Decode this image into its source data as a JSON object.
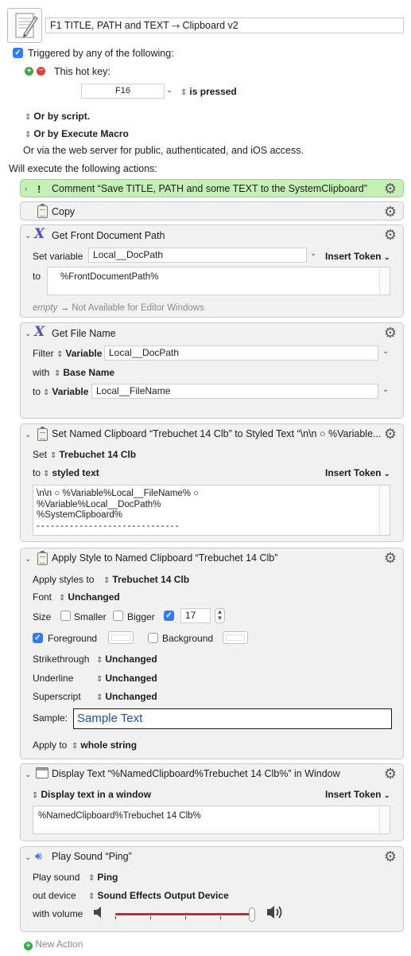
{
  "macro": {
    "title": "F1 TITLE,  PATH and TEXT  ⤑ Clipboard v2"
  },
  "trigger": {
    "triggered_label": "Triggered by any of the following:",
    "hotkey_label": "This hot key:",
    "hotkey_value": "F16",
    "pressed_label": "is pressed",
    "or_script": "Or by script.",
    "or_execute_macro": "Or by Execute Macro",
    "web_server": "Or via the web server for public, authenticated, and iOS access.",
    "will_execute": "Will execute the following actions:"
  },
  "actions": {
    "comment": {
      "title": "Comment “Save TITLE,  PATH and some TEXT to the SystemClipboard”"
    },
    "copy": {
      "title": "Copy"
    },
    "front_doc": {
      "title": "Get Front Document Path",
      "set_variable_label": "Set variable",
      "variable": "Local__DocPath",
      "insert_token": "Insert Token",
      "to_label": "to",
      "to_value": "%FrontDocumentPath%",
      "empty_label": "empty",
      "empty_note": "Not Available for Editor Windows"
    },
    "file_name": {
      "title": "Get File Name",
      "filter_label": "Filter",
      "filter_type": "Variable",
      "filter_value": "Local__DocPath",
      "with_label": "with",
      "with_value": "Base Name",
      "to_label": "to",
      "to_type": "Variable",
      "to_value": "Local__FileName"
    },
    "named_clip": {
      "title": "Set Named Clipboard “Trebuchet 14 Clb” to Styled Text “\\n\\n ○ %Variable...",
      "set_label": "Set",
      "clipboard": "Trebuchet 14 Clb",
      "to_label": "to",
      "styled_text": "styled text",
      "insert_token": "Insert Token",
      "lines": [
        "\\n\\n ○ %Variable%Local__FileName% ○",
        "%Variable%Local__DocPath%",
        "%SystemClipboard%",
        "- - - - - - - - - - - - - - - - - - - - - - - - - - - - - -"
      ]
    },
    "apply_style": {
      "title": "Apply Style to Named Clipboard “Trebuchet 14 Clb”",
      "apply_styles_label": "Apply styles to",
      "clipboard": "Trebuchet 14 Clb",
      "font_label": "Font",
      "font_value": "Unchanged",
      "size_label": "Size",
      "smaller": "Smaller",
      "bigger": "Bigger",
      "size_value": "17",
      "foreground": "Foreground",
      "background": "Background",
      "strikethrough_label": "Strikethrough",
      "strikethrough_value": "Unchanged",
      "underline_label": "Underline",
      "underline_value": "Unchanged",
      "superscript_label": "Superscript",
      "superscript_value": "Unchanged",
      "sample_label": "Sample:",
      "sample_text": "Sample Text",
      "apply_to_label": "Apply to",
      "apply_to_value": "whole string"
    },
    "display_text": {
      "title": "Display Text “%NamedClipboard%Trebuchet 14 Clb%” in Window",
      "mode": "Display text in a window",
      "insert_token": "Insert Token",
      "value": "%NamedClipboard%Trebuchet 14 Clb%"
    },
    "play_sound": {
      "title": "Play Sound “Ping”",
      "play_sound_label": "Play sound",
      "sound": "Ping",
      "out_device_label": "out device",
      "device": "Sound Effects Output Device",
      "volume_label": "with volume",
      "volume": 1.0
    }
  },
  "new_action": "New Action",
  "colors": {
    "comment_bg": "#c6efb6",
    "accent": "#2f7cf6",
    "volume_track": "#d0262b",
    "sample_text": "#1f4ea8"
  }
}
